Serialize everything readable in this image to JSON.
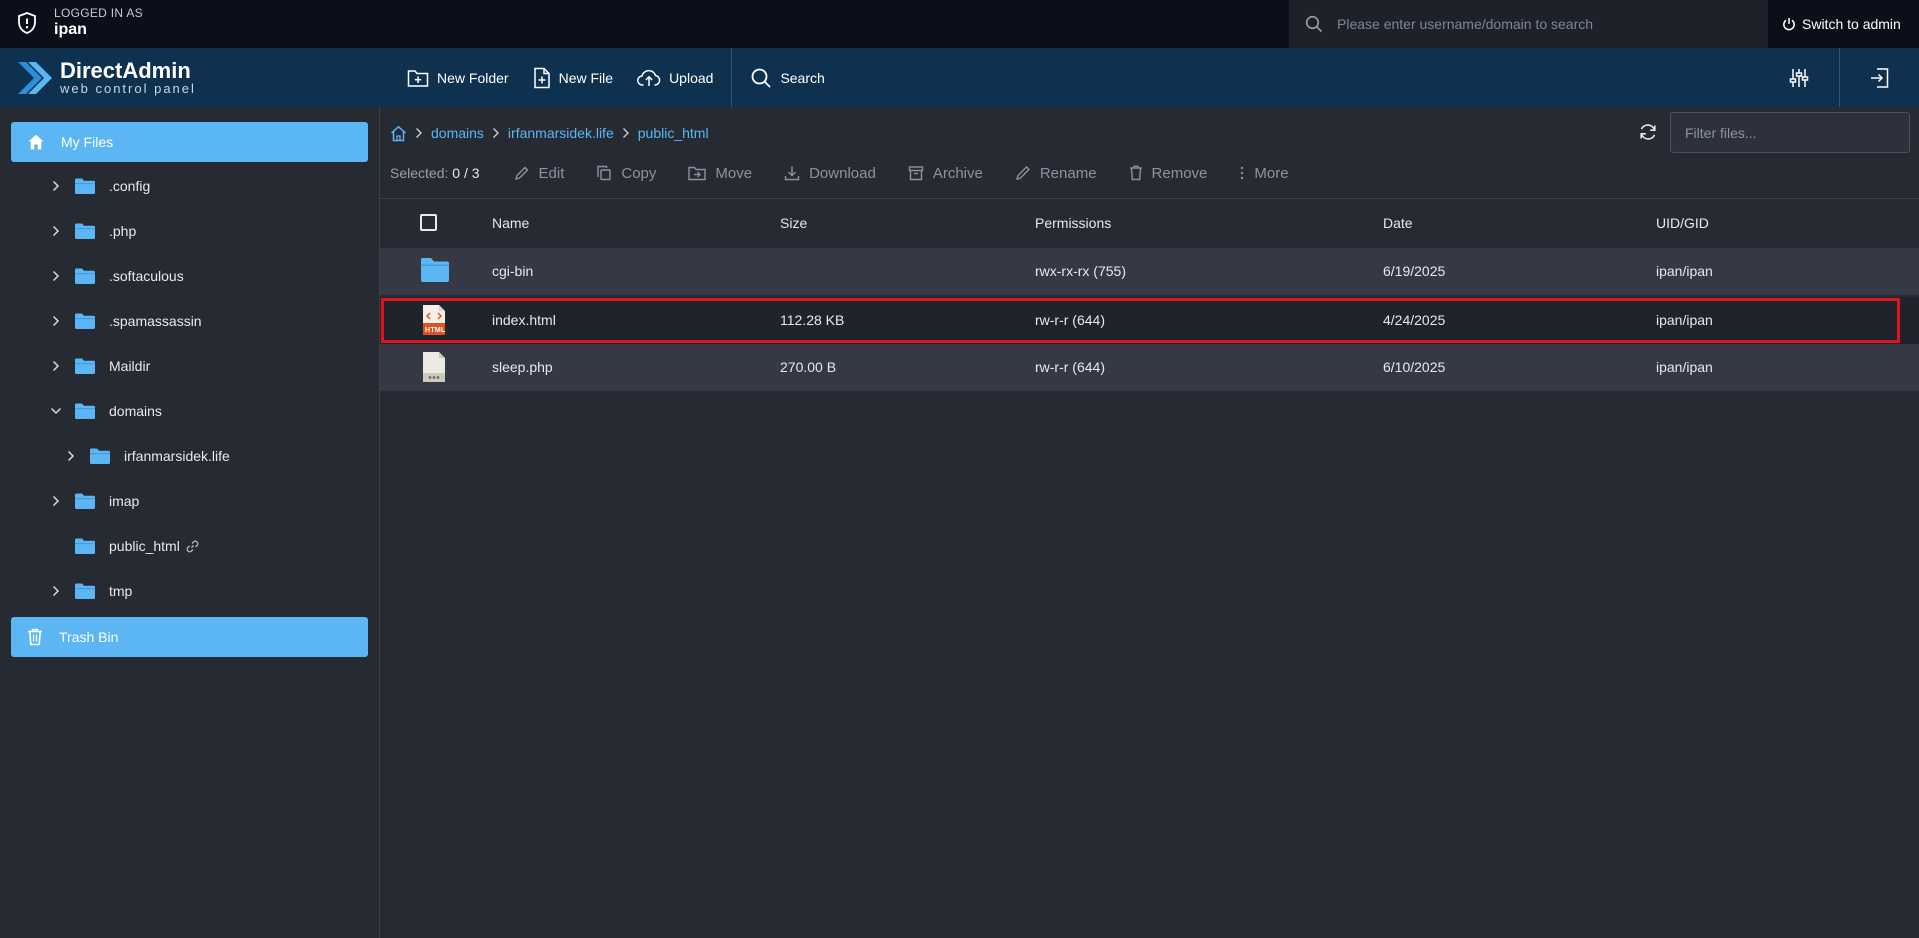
{
  "topbar": {
    "logged_in_label": "LOGGED IN AS",
    "username": "ipan",
    "search_placeholder": "Please enter username/domain to search",
    "switch_label": "Switch to admin"
  },
  "brand": {
    "name": "DirectAdmin",
    "tagline": "web control panel"
  },
  "nav": {
    "new_folder": "New Folder",
    "new_file": "New File",
    "upload": "Upload",
    "search": "Search"
  },
  "sidebar": {
    "my_files": "My Files",
    "trash": "Trash Bin",
    "tree": [
      {
        "label": ".config"
      },
      {
        "label": ".php"
      },
      {
        "label": ".softaculous"
      },
      {
        "label": ".spamassassin"
      },
      {
        "label": "Maildir"
      },
      {
        "label": "domains"
      },
      {
        "label": "irfanmarsidek.life"
      },
      {
        "label": "imap"
      },
      {
        "label": "public_html"
      },
      {
        "label": "tmp"
      }
    ]
  },
  "breadcrumb": [
    "domains",
    "irfanmarsidek.life",
    "public_html"
  ],
  "filter_placeholder": "Filter files...",
  "toolbar": {
    "selected_label": "Selected:",
    "selected_count": "0 / 3",
    "edit": "Edit",
    "copy": "Copy",
    "move": "Move",
    "download": "Download",
    "archive": "Archive",
    "rename": "Rename",
    "remove": "Remove",
    "more": "More"
  },
  "table": {
    "headers": [
      "Name",
      "Size",
      "Permissions",
      "Date",
      "UID/GID"
    ],
    "rows": [
      {
        "name": "cgi-bin",
        "size": "",
        "permissions": "rwx-rx-rx (755)",
        "date": "6/19/2025",
        "uid": "ipan/ipan",
        "icon": "folder-icon"
      },
      {
        "name": "index.html",
        "size": "112.28 KB",
        "permissions": "rw-r-r (644)",
        "date": "4/24/2025",
        "uid": "ipan/ipan",
        "icon": "html-file-icon",
        "icon_text": "HTML"
      },
      {
        "name": "sleep.php",
        "size": "270.00 B",
        "permissions": "rw-r-r (644)",
        "date": "6/10/2025",
        "uid": "ipan/ipan",
        "icon": "php-file-icon"
      }
    ]
  },
  "colors": {
    "accent": "#5cb6f3",
    "navbar": "#0f3150",
    "topbar": "#0a0f1a",
    "highlight": "#e0141e"
  }
}
